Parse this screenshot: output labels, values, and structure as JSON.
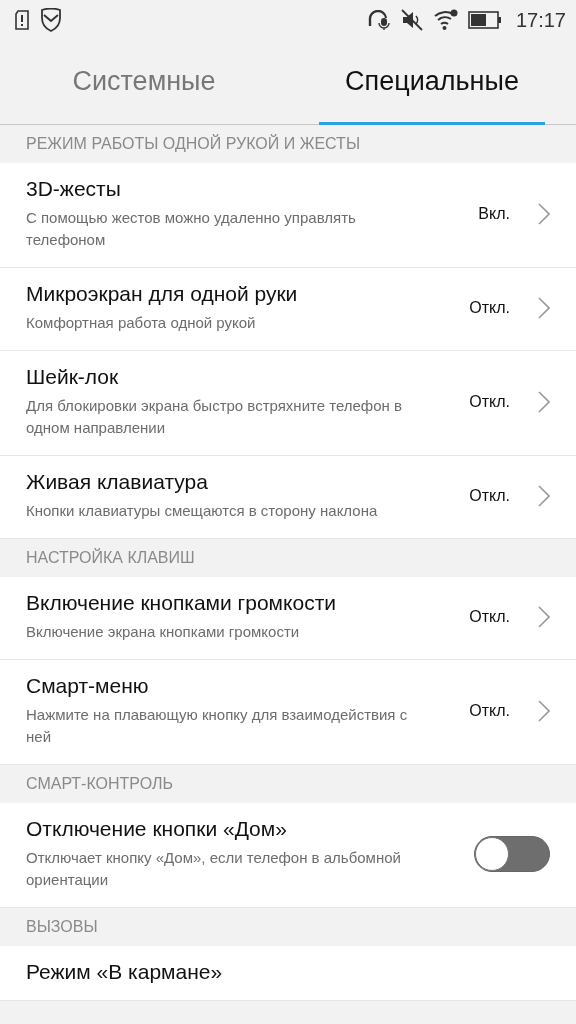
{
  "status_bar": {
    "time": "17:17"
  },
  "tabs": [
    {
      "label": "Системные",
      "selected": false
    },
    {
      "label": "Специальные",
      "selected": true
    }
  ],
  "sections": [
    {
      "header": "РЕЖИМ РАБОТЫ ОДНОЙ РУКОЙ И ЖЕСТЫ",
      "items": [
        {
          "kind": "link",
          "title": "3D-жесты",
          "description": "С помощью жестов можно удаленно управлять телефоном",
          "value": "Вкл."
        },
        {
          "kind": "link",
          "title": "Микроэкран для одной руки",
          "description": "Комфортная работа одной рукой",
          "value": "Откл."
        },
        {
          "kind": "link",
          "title": "Шейк-лок",
          "description": "Для блокировки экрана быстро встряхните телефон в одном направлении",
          "value": "Откл."
        },
        {
          "kind": "link",
          "title": "Живая клавиатура",
          "description": "Кнопки клавиатуры смещаются в сторону наклона",
          "value": "Откл."
        }
      ]
    },
    {
      "header": "НАСТРОЙКА КЛАВИШ",
      "items": [
        {
          "kind": "link",
          "title": "Включение кнопками громкости",
          "description": "Включение экрана кнопками громкости",
          "value": "Откл."
        },
        {
          "kind": "link",
          "title": "Смарт-меню",
          "description": "Нажмите на плавающую кнопку для взаимодействия с ней",
          "value": "Откл."
        }
      ]
    },
    {
      "header": "СМАРТ-КОНТРОЛЬ",
      "items": [
        {
          "kind": "toggle",
          "title": "Отключение кнопки «Дом»",
          "description": "Отключает кнопку «Дом», если телефон в альбомной ориентации",
          "on": false
        }
      ]
    },
    {
      "header": "ВЫЗОВЫ",
      "items": [
        {
          "kind": "plain",
          "title": "Режим «В кармане»"
        }
      ]
    }
  ]
}
